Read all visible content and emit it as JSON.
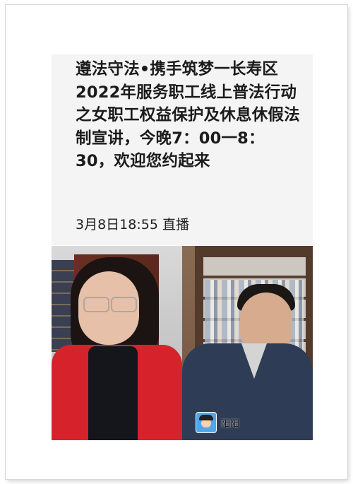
{
  "post": {
    "title": "遵法守法•携手筑梦一长寿区2022年服务职工线上普法行动之女职工权益保护及休息休假法制宣讲，今晚7：00一8：30，欢迎您约起来",
    "live_text": "3月8日18:55 直播"
  },
  "video": {
    "participant_name": "阳阳"
  }
}
